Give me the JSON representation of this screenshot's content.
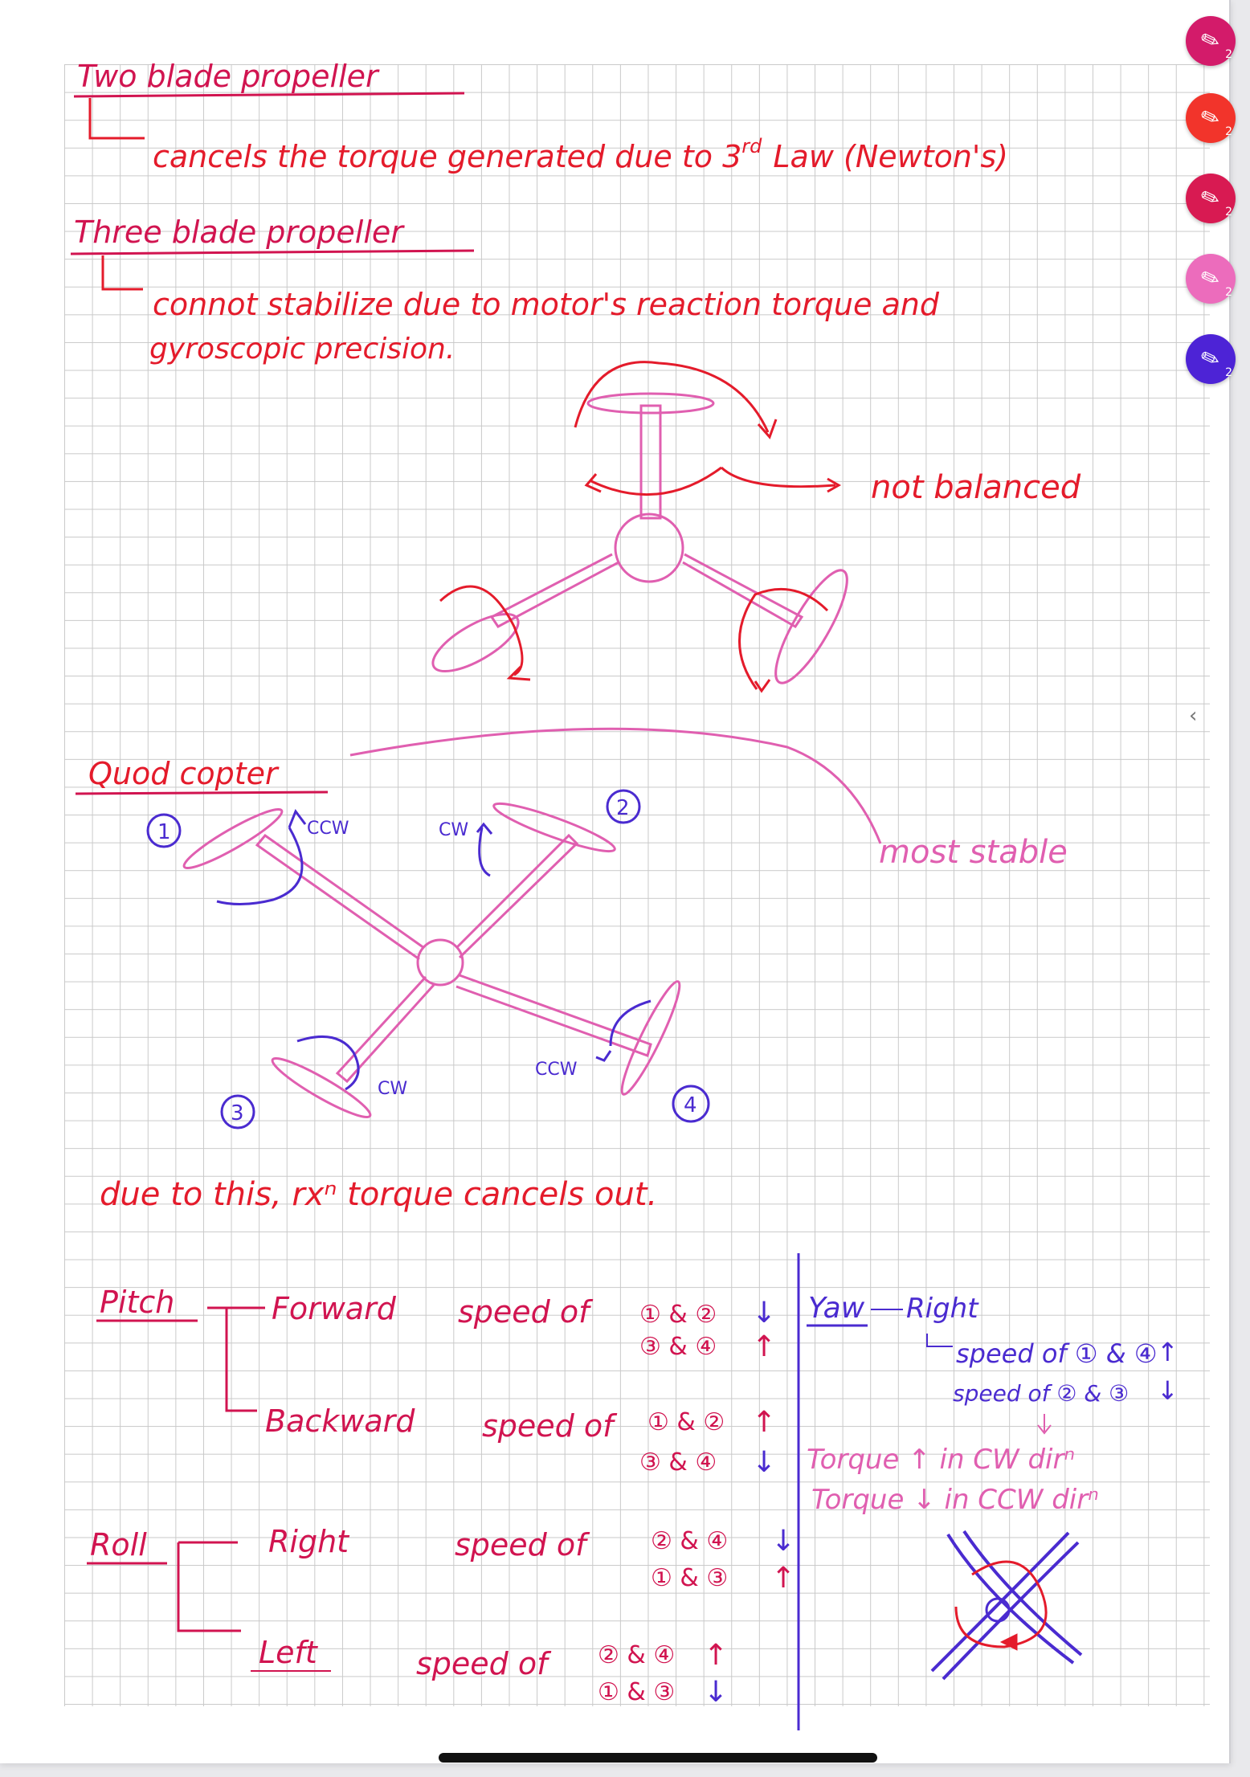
{
  "notes": {
    "title1": "Two blade propeller",
    "line1": "cancels the torque generated due to 3",
    "line1_sup": "rd",
    "line1_end": "Law (Newton's)",
    "title2": "Three blade propeller",
    "line2a": "connot stabilize due to motor's reaction torque and",
    "line2b": "gyroscopic precision.",
    "not_balanced": "not balanced",
    "title3": "Quod copter",
    "most_stable": "most stable",
    "labels": {
      "n1": "1",
      "n2": "2",
      "n3": "3",
      "n4": "4",
      "ccw1": "CCW",
      "cw2": "CW",
      "cw3": "CW",
      "ccw4": "CCW"
    },
    "conclusion": "due to this, rxⁿ torque cancels out.",
    "pitch": {
      "heading": "Pitch",
      "forward": "Forward",
      "forward_speed": "speed of",
      "forward_a": "① & ②",
      "forward_b": "③ & ④",
      "backward": "Backward",
      "backward_speed": "speed of",
      "backward_a": "① & ②",
      "backward_b": "③ & ④"
    },
    "roll": {
      "heading": "Roll",
      "right": "Right",
      "right_speed": "speed of",
      "right_a": "② & ④",
      "right_b": "① & ③",
      "left": "Left",
      "left_speed": "speed of",
      "left_a": "② & ④",
      "left_b": "① & ③"
    },
    "yaw": {
      "heading": "Yaw",
      "right": "Right",
      "speed_a": "speed of ① & ④",
      "speed_b": "speed of ② & ③",
      "torque_a": "Torque ↑ in CW dirⁿ",
      "torque_b": "Torque ↓ in CCW dirⁿ"
    },
    "arrows": {
      "up": "↑",
      "down": "↓"
    }
  },
  "toolbar": {
    "pens": [
      {
        "name": "pen-magenta",
        "color": "#d31b6a",
        "count": "2"
      },
      {
        "name": "pen-red",
        "color": "#f2342b",
        "count": "2"
      },
      {
        "name": "pen-crimson",
        "color": "#d81a52",
        "count": "2"
      },
      {
        "name": "pen-pink",
        "color": "#ec6cbc",
        "count": "2"
      },
      {
        "name": "pen-purple",
        "color": "#4d23d6",
        "count": "2"
      }
    ],
    "collapse_icon": "‹"
  },
  "colors": {
    "red": "#e41b2b",
    "crimson": "#d11450",
    "pink": "#e05fb0",
    "purple": "#4a2bd0"
  }
}
